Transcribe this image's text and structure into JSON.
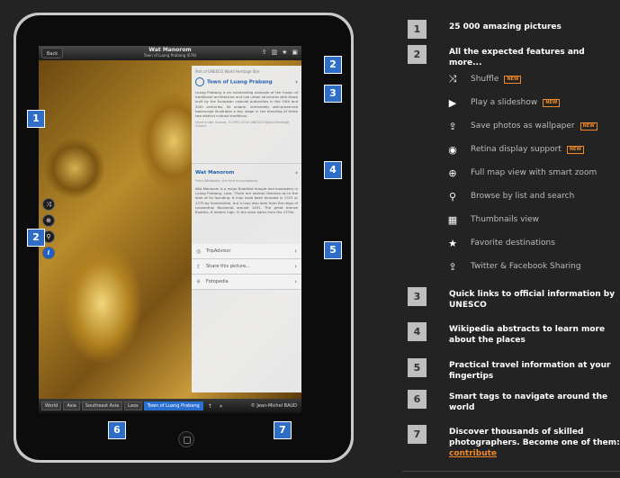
{
  "ipad": {
    "topbar": {
      "back_label": "Back",
      "title": "Wat Manorom",
      "subtitle": "Town of Luang Prabang (678)"
    },
    "panel": {
      "unesco_header": "Part of UNESCO World Heritage Site",
      "unesco_link": "Town of Luang Prabang",
      "unesco_body": "Luang Prabang is an outstanding example of the fusion of traditional architecture and Lao urban structures with those built by the European colonial authorities in the 19th and 20th centuries. Its unique, remarkably well-preserved townscape illustrates a key stage in the blending of these two distinct cultural traditions.",
      "unesco_license": "Used under license, ©1992-2010 UNESCO World Heritage Centre",
      "wiki_link": "Wat Manorom",
      "wiki_source": "From Wikipedia, the free encyclopedia",
      "wiki_body": "Wat Manorom is a major Buddhist temple and monastery in Luang Prabang, Laos. There are several theories as to the date of its founding. It may have been founded in 1372 or 1375 by Samsenthai, but it may also date from the reign of Lanxanthai Bouvanat around 1491. The great bronze Buddha, 6 meters high, in the nave dates from the 1370s.",
      "items": [
        {
          "label": "TripAdvisor"
        },
        {
          "label": "Share this picture..."
        },
        {
          "label": "Fotopedia"
        }
      ]
    },
    "crumbs": [
      "World",
      "Asia",
      "Southeast Asia",
      "Laos",
      "Town of Luang Prabang"
    ],
    "crumb_up": "↑",
    "crumb_more": "»",
    "credit": "© Jean-Michel BAUD",
    "badges": [
      "1",
      "2",
      "2",
      "3",
      "4",
      "5",
      "6",
      "7"
    ]
  },
  "features": [
    {
      "num": "1",
      "text": "25 000 amazing pictures"
    },
    {
      "num": "2",
      "text": "All the expected features and more..."
    },
    {
      "num": "3",
      "text": "Quick links to official information by UNESCO"
    },
    {
      "num": "4",
      "text": "Wikipedia abstracts to learn more about the places"
    },
    {
      "num": "5",
      "text": "Practical travel information at your fingertips"
    },
    {
      "num": "6",
      "text": "Smart tags to navigate around the world"
    },
    {
      "num": "7",
      "text": "Discover thousands of skilled photographers. Become one of them:",
      "link": "contribute"
    }
  ],
  "subfeatures": [
    {
      "icon": "shuffle-icon",
      "glyph": "⤨",
      "label": "Shuffle",
      "new": "NEW"
    },
    {
      "icon": "play-icon",
      "glyph": "▶",
      "label": "Play a slideshow",
      "new": "NEW"
    },
    {
      "icon": "share-icon",
      "glyph": "⇪",
      "label": "Save photos as wallpaper",
      "new": "NEW"
    },
    {
      "icon": "eye-icon",
      "glyph": "◉",
      "label": "Retina display support",
      "new": "NEW"
    },
    {
      "icon": "globe-icon",
      "glyph": "⊕",
      "label": "Full map view with smart zoom"
    },
    {
      "icon": "search-icon",
      "glyph": "⚲",
      "label": "Browse by list and search"
    },
    {
      "icon": "thumbnails-icon",
      "glyph": "▦",
      "label": "Thumbnails view"
    },
    {
      "icon": "star-icon",
      "glyph": "★",
      "label": "Favorite destinations"
    },
    {
      "icon": "share-icon",
      "glyph": "⇪",
      "label": "Twitter & Facebook Sharing"
    }
  ]
}
